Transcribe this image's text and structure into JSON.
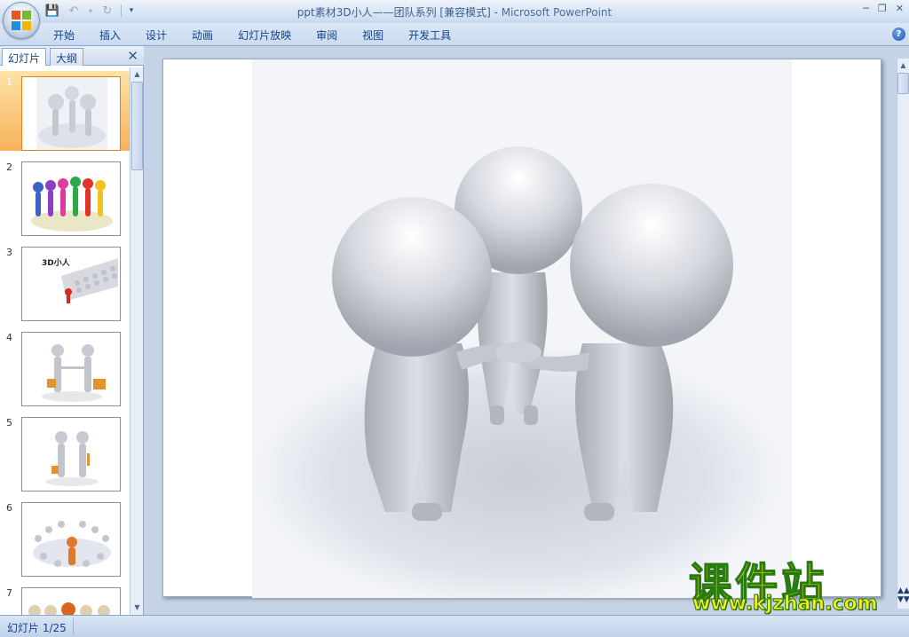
{
  "window": {
    "title": "ppt素材3D小人——团队系列 [兼容模式]",
    "title_sep": " - ",
    "app_name": "Microsoft PowerPoint"
  },
  "ribbon": {
    "tabs": [
      {
        "label": "开始"
      },
      {
        "label": "插入"
      },
      {
        "label": "设计"
      },
      {
        "label": "动画"
      },
      {
        "label": "幻灯片放映"
      },
      {
        "label": "审阅"
      },
      {
        "label": "视图"
      },
      {
        "label": "开发工具"
      }
    ],
    "help_glyph": "?"
  },
  "left_pane": {
    "tab_slides": "幻灯片",
    "tab_outline": "大纲",
    "thumbnails": [
      {
        "num": "1",
        "caption": ""
      },
      {
        "num": "2",
        "caption": ""
      },
      {
        "num": "3",
        "caption": "3D小人"
      },
      {
        "num": "4",
        "caption": ""
      },
      {
        "num": "5",
        "caption": ""
      },
      {
        "num": "6",
        "caption": ""
      },
      {
        "num": "7",
        "caption": ""
      }
    ]
  },
  "watermark": {
    "chinese": "课件站",
    "url": "www.kjzhan.com"
  },
  "status": {
    "slide_indicator": "幻灯片 1/25"
  },
  "colors": {
    "ribbon_text": "#15428b",
    "selection": "#f7b25a",
    "watermark_fill": "#f6ef1a",
    "watermark_stroke": "#2a7a12"
  }
}
